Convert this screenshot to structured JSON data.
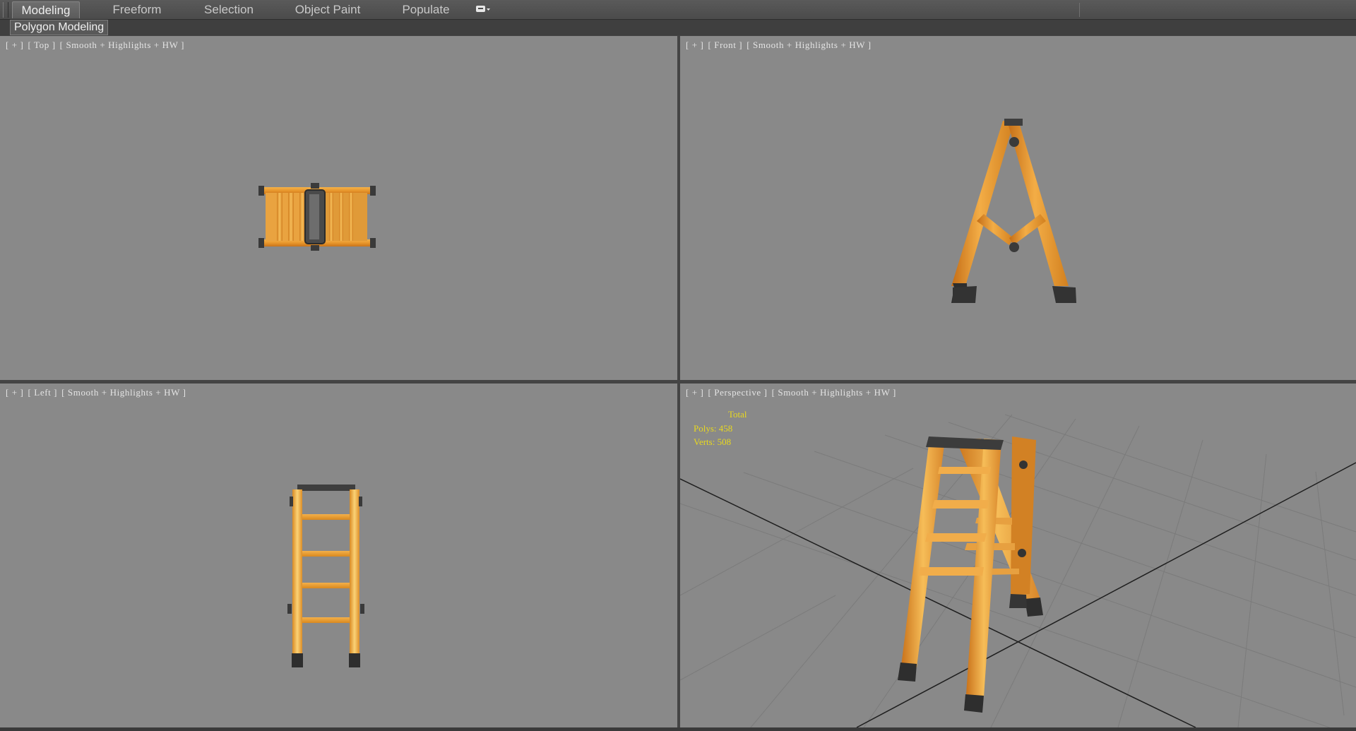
{
  "ribbon": {
    "tabs": [
      {
        "label": "Modeling",
        "active": true
      },
      {
        "label": "Freeform",
        "active": false
      },
      {
        "label": "Selection",
        "active": false
      },
      {
        "label": "Object Paint",
        "active": false
      },
      {
        "label": "Populate",
        "active": false
      }
    ],
    "options_icon": "ribbon-options-dropdown-icon"
  },
  "panel": {
    "label": "Polygon Modeling"
  },
  "viewports": {
    "top": {
      "plus": "[ + ]",
      "view": "[ Top ]",
      "shading": "[ Smooth + Highlights + HW ]"
    },
    "front": {
      "plus": "[ + ]",
      "view": "[ Front ]",
      "shading": "[ Smooth + Highlights + HW ]"
    },
    "left": {
      "plus": "[ + ]",
      "view": "[ Left ]",
      "shading": "[ Smooth + Highlights + HW ]"
    },
    "perspective": {
      "plus": "[ + ]",
      "view": "[ Perspective ]",
      "shading": "[ Smooth + Highlights + HW ]",
      "stats": {
        "total_label": "Total",
        "polys": "Polys: 458",
        "verts": "Verts: 508"
      }
    }
  },
  "colors": {
    "viewport_bg": "#898989",
    "wood": "#e8962c",
    "wood_light": "#f6be5a",
    "metal": "#3c3c3c",
    "stats_text": "#e8d820",
    "grid": "#7a7a7a"
  }
}
